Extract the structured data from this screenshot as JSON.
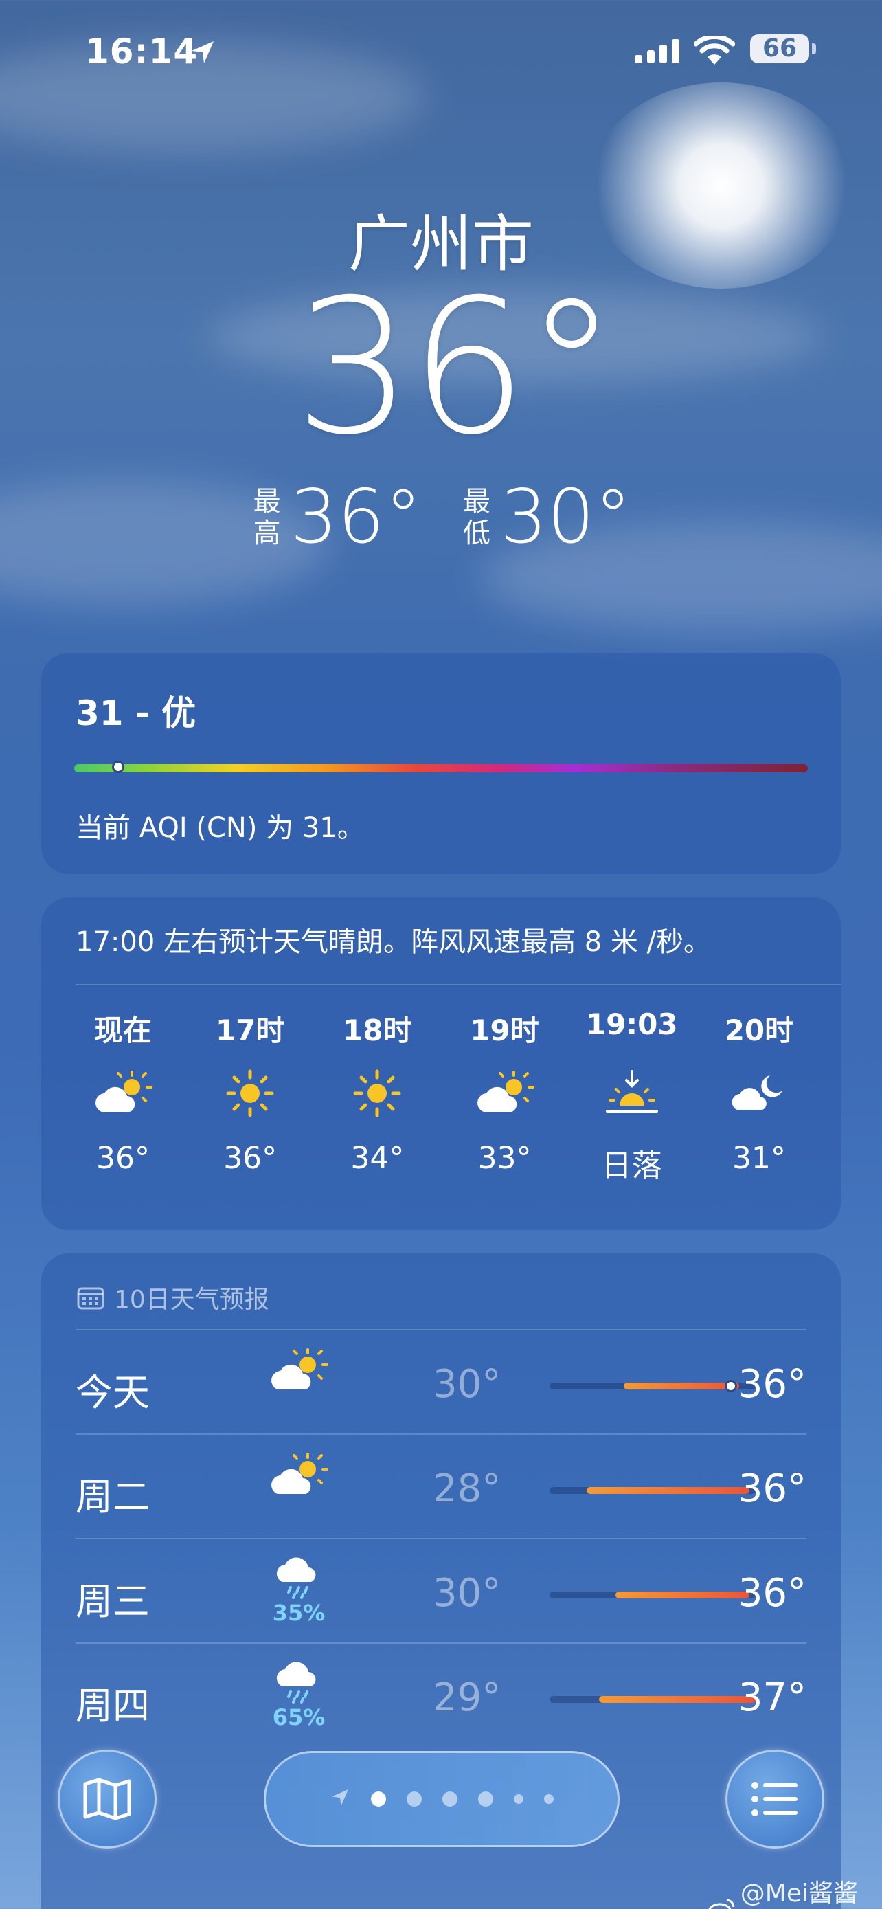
{
  "status_bar": {
    "time": "16:14",
    "battery": "66"
  },
  "header": {
    "city": "广州市",
    "temperature": "36°",
    "high_label": "最高",
    "high": "36°",
    "low_label": "最低",
    "low": "30°"
  },
  "aqi": {
    "title": "31 - 优",
    "description": "当前 AQI (CN) 为 31。",
    "level_fraction": 0.06
  },
  "hourly": {
    "summary": "17:00 左右预计天气晴朗。阵风风速最高 8 米 /秒。",
    "items": [
      {
        "time": "现在",
        "icon": "partly-cloudy-icon",
        "temp": "36°"
      },
      {
        "time": "17时",
        "icon": "sun-icon",
        "temp": "36°"
      },
      {
        "time": "18时",
        "icon": "sun-icon",
        "temp": "34°"
      },
      {
        "time": "19时",
        "icon": "partly-cloudy-icon",
        "temp": "33°"
      },
      {
        "time": "19:03",
        "icon": "sunset-icon",
        "temp": "日落"
      },
      {
        "time": "20时",
        "icon": "moon-cloud-icon",
        "temp": "31°"
      }
    ]
  },
  "daily": {
    "header": "10日天气预报",
    "rows": [
      {
        "day": "今天",
        "icon": "partly-cloudy-icon",
        "precip": "",
        "low": "30°",
        "high": "36°",
        "range_start": 0.36,
        "range_end": 0.92,
        "current": 0.88
      },
      {
        "day": "周二",
        "icon": "partly-cloudy-icon",
        "precip": "",
        "low": "28°",
        "high": "36°",
        "range_start": 0.18,
        "range_end": 0.97
      },
      {
        "day": "周三",
        "icon": "rain-cloud-icon",
        "precip": "35%",
        "low": "30°",
        "high": "36°",
        "range_start": 0.32,
        "range_end": 0.97
      },
      {
        "day": "周四",
        "icon": "rain-cloud-icon",
        "precip": "65%",
        "low": "29°",
        "high": "37°",
        "range_start": 0.24,
        "range_end": 1.0
      }
    ]
  },
  "toolbar": {
    "page_count": 7,
    "current_page": 2
  },
  "watermark": "@Mei酱酱酱",
  "colors": {
    "accent_precip": "#7ed4ff",
    "sun": "#f7c525",
    "temp_bar": "#e9553c"
  }
}
